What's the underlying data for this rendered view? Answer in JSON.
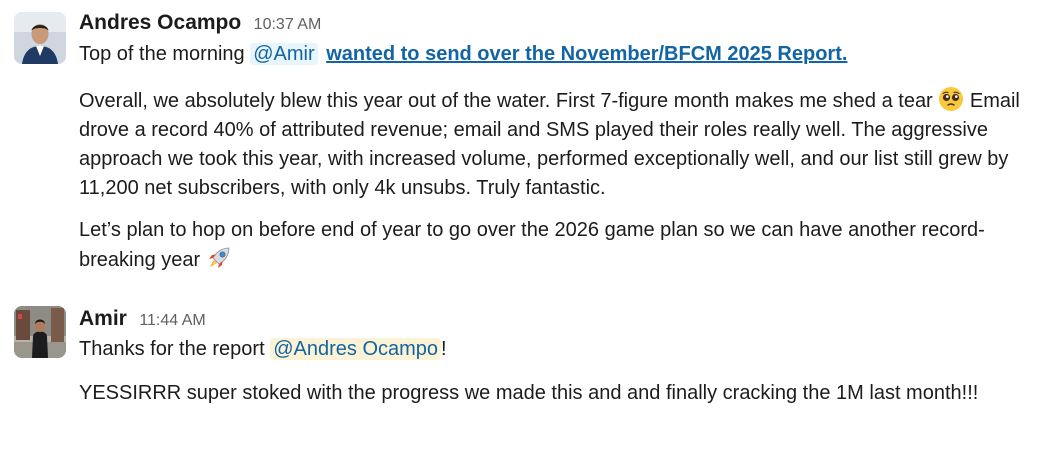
{
  "messages": [
    {
      "sender": "Andres Ocampo",
      "timestamp": "10:37 AM",
      "avatar": "profile-photo-andres",
      "intro_text": "Top of the morning",
      "intro_mention": "@Amir",
      "intro_link": "wanted to send over the November/BFCM 2025 Report.",
      "para1_part1": "Overall, we absolutely blew this year out of the water. First 7-figure month makes me shed a tear",
      "para1_part2": "Email drove a record 40% of attributed revenue; email and SMS played their roles really well. The aggressive approach we took this year, with increased volume, performed exceptionally well, and our list still grew by 11,200 net subscribers, with only 4k unsubs. Truly fantastic.",
      "para2": "Let’s plan to hop on before end of year to go over the 2026 game plan so we can have another record-breaking year",
      "emoji_1": "pleading-face-emoji",
      "emoji_2": "rocket-emoji"
    },
    {
      "sender": "Amir",
      "timestamp": "11:44 AM",
      "avatar": "profile-photo-amir",
      "line1_text": "Thanks for the report",
      "line1_mention": "@Andres Ocampo",
      "line1_end": "!",
      "para2": "YESSIRRR super stoked with the progress we made this and and finally cracking the 1M last month!!!"
    }
  ],
  "colors": {
    "link": "#1264a3",
    "mention_bg_other": "#e8f5fa",
    "mention_bg_self": "#fcf3d7",
    "timestamp": "#616061",
    "text": "#1d1c1d"
  }
}
